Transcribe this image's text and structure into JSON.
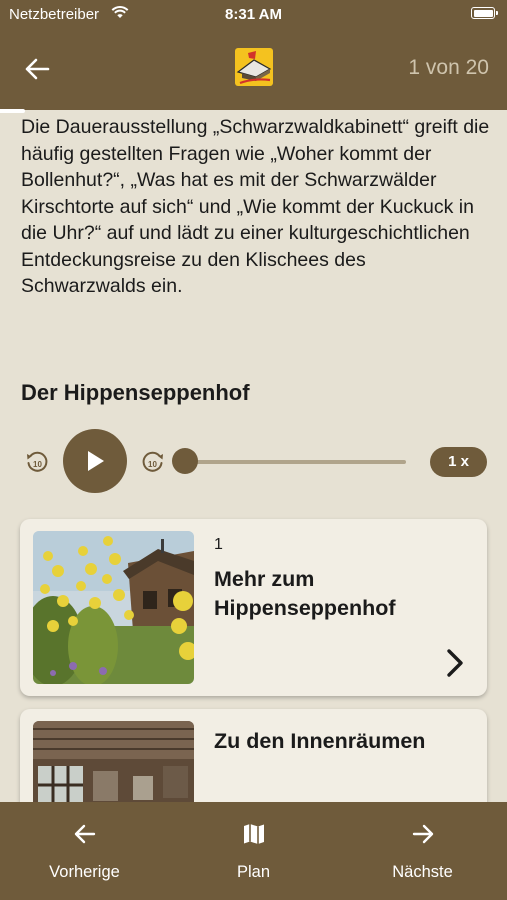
{
  "status_bar": {
    "carrier": "Netzbetreiber",
    "time": "8:31 AM"
  },
  "header": {
    "counter": "1 von 20",
    "progress_fraction": 0.05
  },
  "intro_text": "Die Dauerausstellung „Schwarzwaldkabinett“ greift die häufig gestellten Fragen wie „Woher kommt der Bollenhut?“, „Was hat es mit der Schwarzwälder Kirschtorte auf sich“ und „Wie kommt der Kuckuck in die Uhr?“ auf und lädt zu einer kulturgeschichtlichen Entdeckungsreise zu den Klischees des Schwarzwalds ein.",
  "section_title": "Der Hippenseppenhof",
  "player": {
    "skip_back_seconds": "10",
    "skip_forward_seconds": "10",
    "speed": "1 x",
    "position_fraction": 0.0
  },
  "cards": [
    {
      "number": "1",
      "title": "Mehr zum Hippenseppenhof"
    },
    {
      "number": "",
      "title": "Zu den Innenräumen"
    }
  ],
  "tabbar": {
    "previous": "Vorherige",
    "plan": "Plan",
    "next": "Nächste"
  },
  "colors": {
    "brand_brown": "#6f5b3b",
    "background": "#e6e1d3",
    "card": "#f2eee4"
  }
}
